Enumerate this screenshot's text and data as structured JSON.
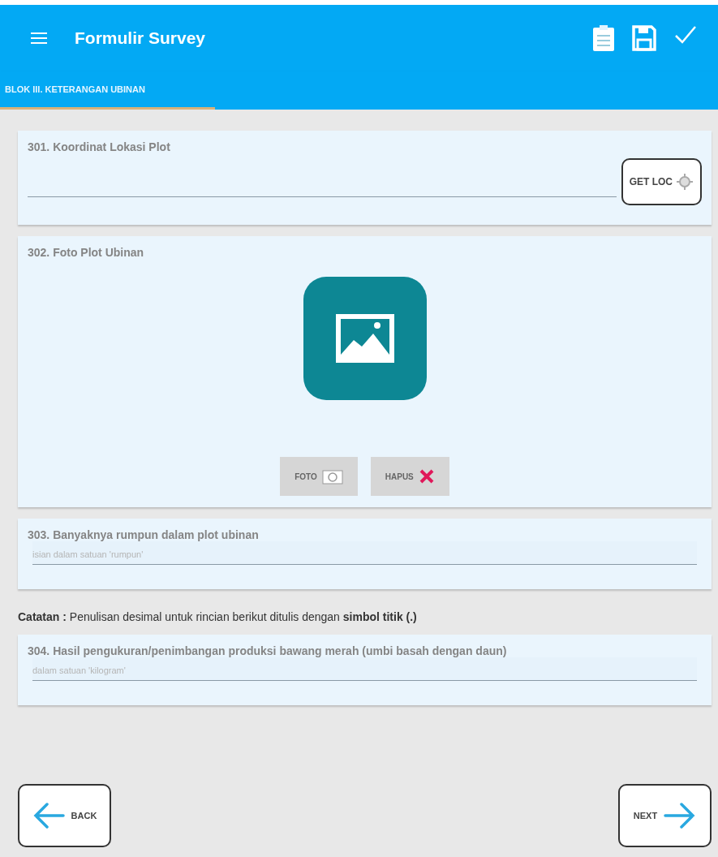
{
  "app_bar": {
    "title": "Formulir Survey"
  },
  "tabs": [
    {
      "label": "BLOK III. KETERANGAN UBINAN",
      "selected": true
    }
  ],
  "questions": [
    {
      "kind": "location",
      "label": "301. Koordinat Lokasi Plot",
      "button": "GET LOC"
    },
    {
      "kind": "photo",
      "label": "302. Foto Plot Ubinan",
      "buttons": [
        {
          "kind": "camera",
          "label": "FOTO"
        },
        {
          "kind": "delete",
          "label": "HAPUS"
        }
      ]
    },
    {
      "kind": "input",
      "label": "303. Banyaknya rumpun dalam plot ubinan",
      "placeholder": "isian dalam satuan 'rumpun'"
    },
    {
      "kind": "note",
      "text": "**Catatan :** Penulisan desimal untuk rincian berikut ditulis dengan **simbol titik (.)**"
    },
    {
      "kind": "input",
      "label": "304. Hasil pengukuran/penimbangan produksi bawang merah (umbi basah dengan daun)",
      "placeholder": "dalam satuan 'kilogram'"
    }
  ],
  "navigation": {
    "back": "BACK",
    "next": "NEXT"
  }
}
